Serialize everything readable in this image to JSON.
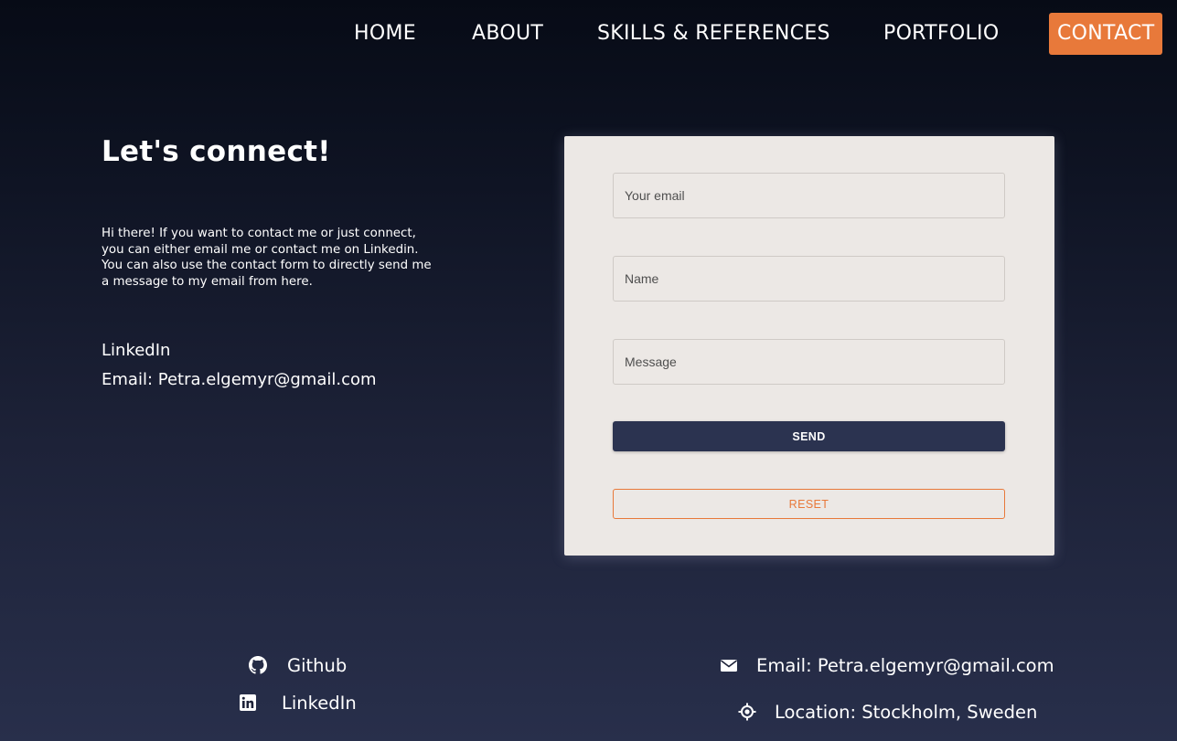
{
  "nav": {
    "home": "HOME",
    "about": "ABOUT",
    "skills": "SKILLS & REFERENCES",
    "portfolio": "PORTFOLIO",
    "contact": "CONTACT"
  },
  "contact_section": {
    "title": "Let's connect!",
    "intro_lines": [
      "Hi there! If you want to contact me or just connect,",
      "you can either email me or contact me on Linkedin.",
      "You can also use the contact form to directly send me",
      "a message to my email from here."
    ],
    "linkedin_link": "LinkedIn",
    "email_text": "Email: Petra.elgemyr@gmail.com"
  },
  "form": {
    "email_placeholder": "Your email",
    "name_placeholder": "Name",
    "message_placeholder": "Message",
    "send_label": "SEND",
    "reset_label": "RESET"
  },
  "footer": {
    "github_label": "Github",
    "linkedin_label": "LinkedIn",
    "email_label": "Email: Petra.elgemyr@gmail.com",
    "location_label": "Location: Stockholm, Sweden"
  },
  "colors": {
    "accent": "#e8793a",
    "button_dark": "#2b3350",
    "card_bg": "#ece8e5",
    "bg_top": "#070b16",
    "bg_bottom": "#282f4b"
  },
  "icons": {
    "github": "github-icon",
    "linkedin": "linkedin-icon",
    "email": "envelope-icon",
    "location": "location-crosshair-icon"
  }
}
